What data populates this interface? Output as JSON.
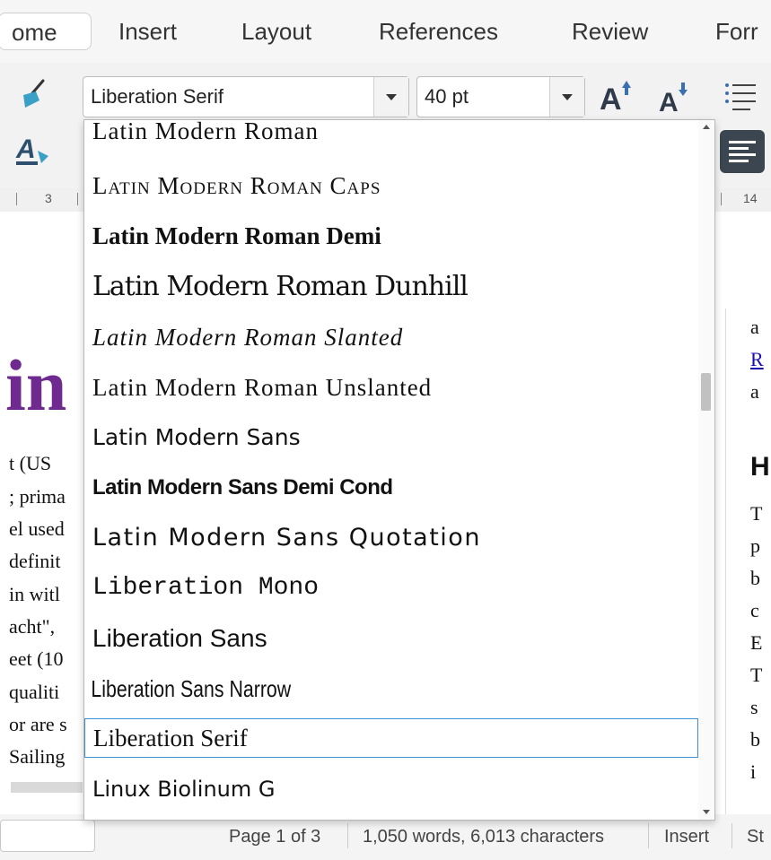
{
  "tabs": [
    {
      "label": "ome",
      "active": true
    },
    {
      "label": "Insert"
    },
    {
      "label": "Layout"
    },
    {
      "label": "References"
    },
    {
      "label": "Review"
    },
    {
      "label": "Forr"
    }
  ],
  "toolbar": {
    "font_name": "Liberation Serif",
    "font_size": "40 pt",
    "grow_icon": "grow-font-icon",
    "shrink_icon": "shrink-font-icon"
  },
  "ruler": {
    "left_num": "3",
    "right_num": "14"
  },
  "font_list": [
    {
      "label": "Latin Modern Roman"
    },
    {
      "label": "Latin Modern Roman Caps"
    },
    {
      "label": "Latin Modern Roman Demi"
    },
    {
      "label": "Latin Modern Roman Dunhill"
    },
    {
      "label": "Latin Modern Roman Slanted"
    },
    {
      "label": "Latin Modern Roman Unslanted"
    },
    {
      "label": "Latin Modern Sans"
    },
    {
      "label": "Latin Modern Sans Demi Cond"
    },
    {
      "label": "Latin Modern Sans Quotation"
    },
    {
      "label": "Liberation Mono"
    },
    {
      "label": "Liberation Sans"
    },
    {
      "label": "Liberation Sans Narrow"
    },
    {
      "label": "Liberation Serif",
      "selected": true
    },
    {
      "label": "Linux Biolinum G"
    }
  ],
  "document": {
    "title_fragment": "in",
    "left_lines": [
      "t (US",
      "; prima",
      "el used",
      "definit",
      "in witl",
      "acht\",",
      "eet (10",
      "qualiti",
      "or are s",
      "Sailing"
    ],
    "right_lines": [
      "a",
      "R",
      "a",
      "H",
      "T",
      "p",
      "b",
      "c",
      "E",
      "T",
      "s",
      "b",
      "i"
    ]
  },
  "status": {
    "page": "Page 1 of 3",
    "words": "1,050 words, 6,013 characters",
    "mode": "Insert",
    "style": "St"
  },
  "colors": {
    "title": "#6e2a8e",
    "selection_border": "#3d8fd1",
    "link": "#1a0dab"
  }
}
